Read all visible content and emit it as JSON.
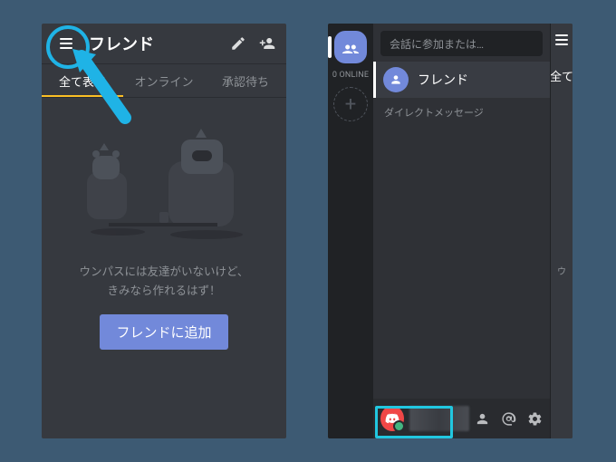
{
  "left": {
    "header": {
      "title": "フレンド"
    },
    "tabs": {
      "all": "全て表示",
      "online": "オンライン",
      "pending": "承認待ち"
    },
    "empty_line1": "ウンパスには友達がいないけど、",
    "empty_line2": "きみなら作れるはず！",
    "add_friend_button": "フレンドに追加",
    "icons": {
      "menu": "menu",
      "compose": "compose",
      "add_friend": "add-friend"
    }
  },
  "right": {
    "online_count_label": "0 ONLINE",
    "search_placeholder": "会話に参加または…",
    "friends_label": "フレンド",
    "dm_header": "ダイレクトメッセージ",
    "edge_tab": "全て",
    "edge_hint": "ウ",
    "bottom_icons": {
      "profile": "profile",
      "mentions": "mentions",
      "settings": "settings"
    }
  },
  "colors": {
    "highlight_cyan": "#21c7e0",
    "accent": "#7289da"
  }
}
